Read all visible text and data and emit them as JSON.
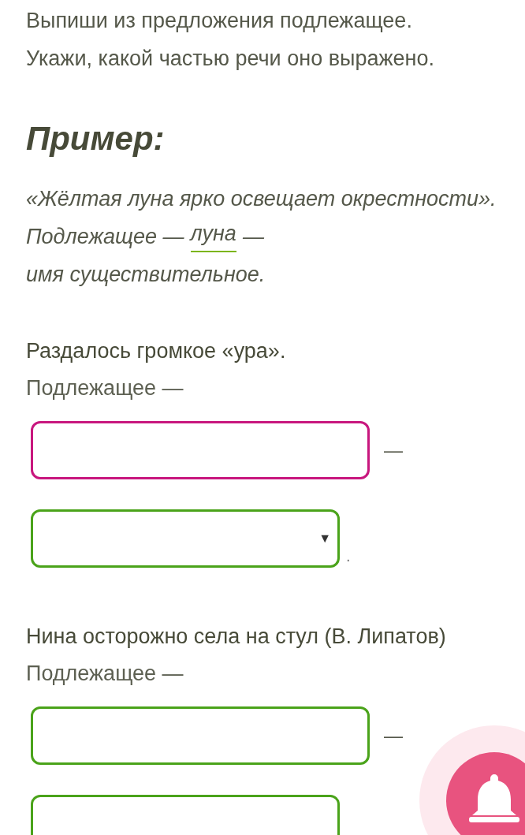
{
  "instruction": [
    "Выпиши из предложения подлежащее.",
    "Укажи, какой частью речи оно выражено."
  ],
  "example": {
    "heading": "Пример:",
    "sentence": "«Жёлтая луна ярко освещает окрестности».",
    "answer_label": "Подлежащее —",
    "answer_word": "луна",
    "answer_dash": "—",
    "part_of_speech": "имя существительное."
  },
  "exercises": [
    {
      "sentence": "Раздалось громкое «ура».",
      "label": "Подлежащее —",
      "input": {
        "highlighted": true
      },
      "separator": "—",
      "has_select": true,
      "select_arrow": "▼",
      "end": "."
    },
    {
      "sentence": "Нина осторожно села на стул (В. Липатов)",
      "label": "Подлежащее —",
      "input": {
        "highlighted": false
      },
      "separator": "—",
      "has_select": true
    }
  ]
}
